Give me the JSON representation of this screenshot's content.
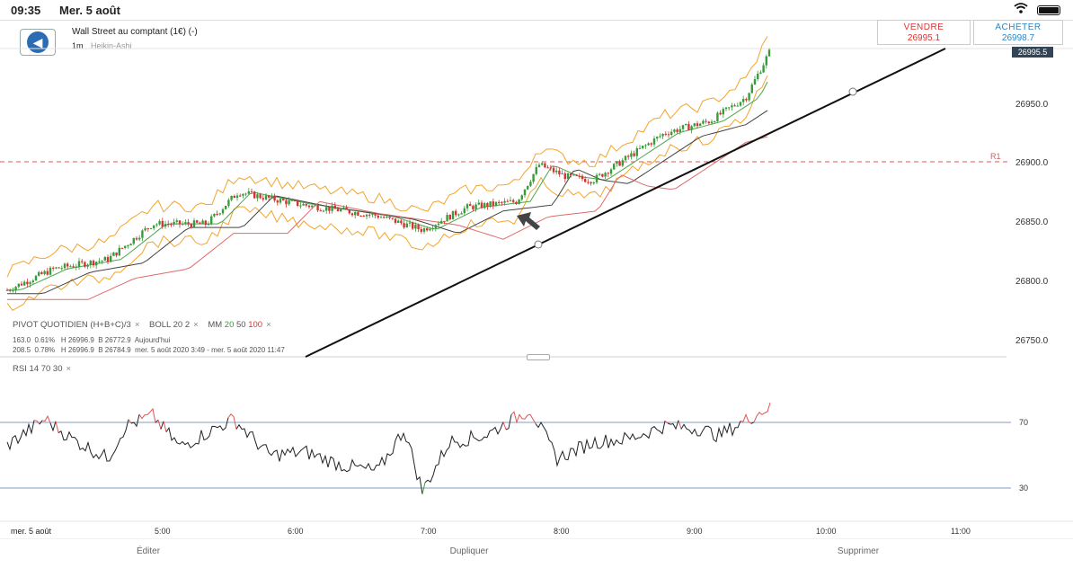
{
  "status_bar": {
    "time": "09:35",
    "date": "Mer. 5 août"
  },
  "header": {
    "instrument": "Wall Street au comptant (1€) (-)",
    "timeframe": "1m",
    "chart_style": "Heikin-Ashi"
  },
  "trade": {
    "sell_label": "VENDRE",
    "sell_price": "26995.1",
    "buy_label": "ACHETER",
    "buy_price": "26998.7"
  },
  "price_axis": [
    "26950.0",
    "26900.0",
    "26850.0",
    "26800.0",
    "26750.0"
  ],
  "current_price_label": "26995.5",
  "pivot_label": "R1",
  "indicators": {
    "pivot": "PIVOT",
    "pivot_type": "QUOTIDIEN",
    "pivot_formula": "(H+B+C)/3",
    "boll": "BOLL",
    "boll_period": "20",
    "boll_dev": "2",
    "mm": "MM",
    "mm_20": "20",
    "mm_50": "50",
    "mm_100": "100",
    "close_glyph": "×"
  },
  "stats": {
    "row1": {
      "change": "163.0",
      "pct": "0.61%",
      "high": "H 26996.9",
      "low": "B 26772.9",
      "period": "Aujourd'hui"
    },
    "row2": {
      "change": "208.5",
      "pct": "0.78%",
      "high": "H 26996.9",
      "low": "B 26784.9",
      "period": "mer. 5 août 2020 3:49 - mer. 5 août 2020 11:47"
    }
  },
  "rsi": {
    "label": "RSI",
    "period": "14",
    "upper": "70",
    "lower": "30",
    "axis_upper": "70",
    "axis_lower": "30"
  },
  "time_axis": {
    "date_label": "mer. 5 août",
    "ticks": [
      "5:00",
      "6:00",
      "7:00",
      "8:00",
      "9:00",
      "10:00",
      "11:00"
    ]
  },
  "bottom_bar": {
    "edit": "Éditer",
    "duplicate": "Dupliquer",
    "delete": "Supprimer"
  },
  "colors": {
    "up": "#3a9b3a",
    "down": "#d33333",
    "boll": "#f2a42c",
    "mm20": "#4aa64a",
    "mm50": "#444444",
    "mm100": "#e06a6a",
    "pivot": "#e05555",
    "rsi_line": "#222222",
    "rsi_band": "#7f9fc0"
  }
}
